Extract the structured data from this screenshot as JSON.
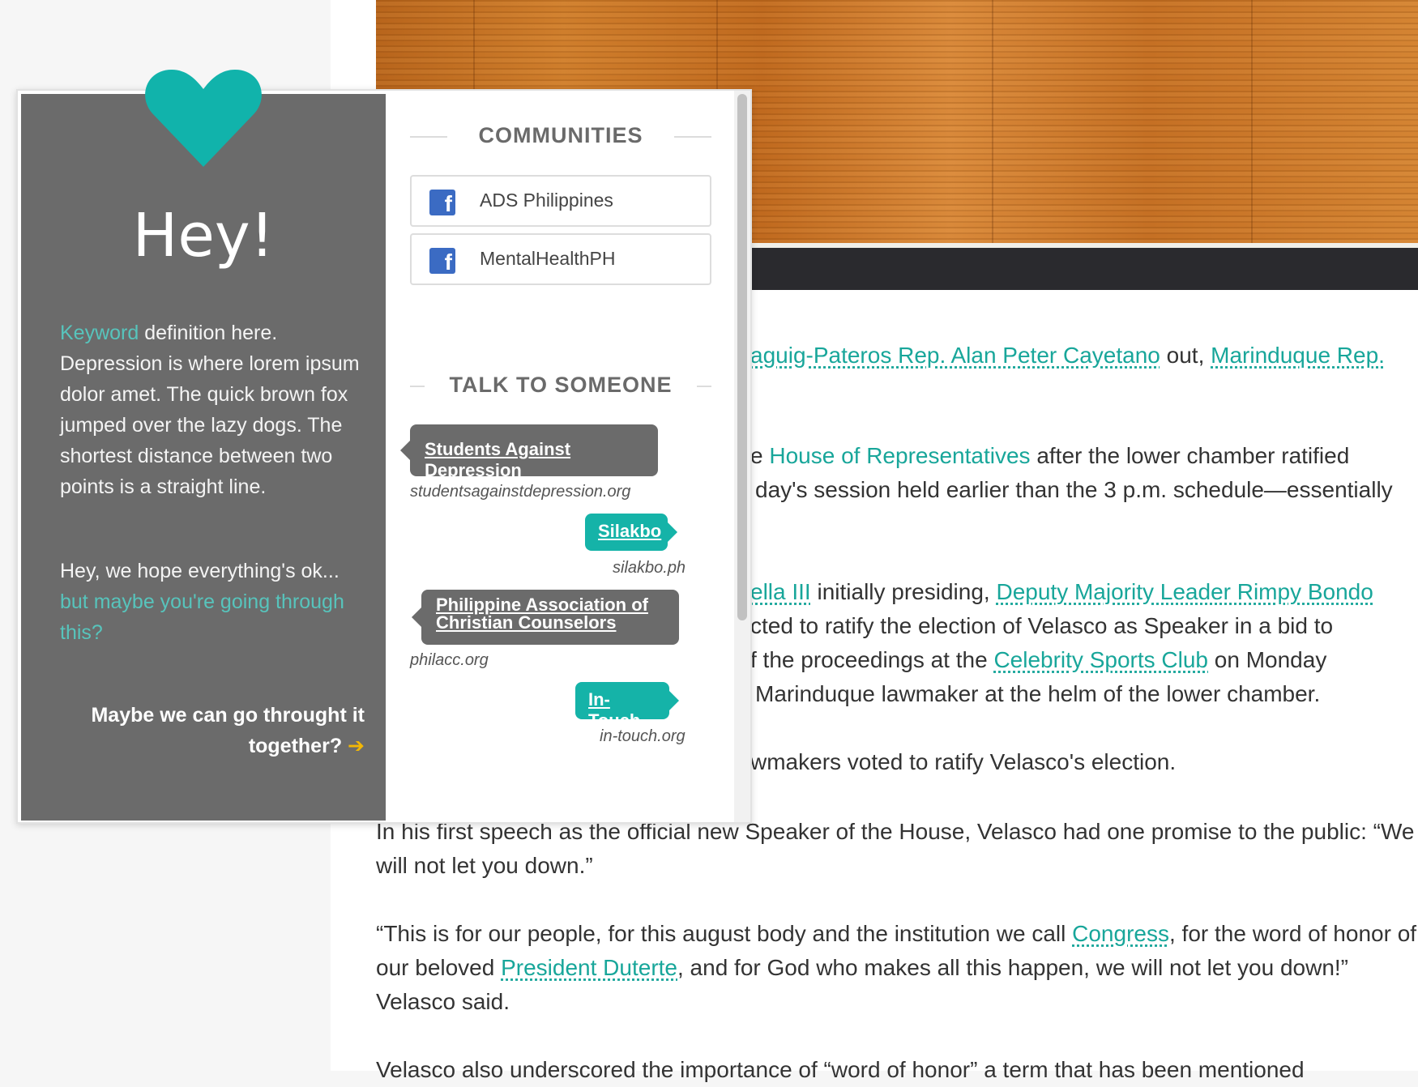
{
  "popup": {
    "heading": "Hey!",
    "keyword": "Keyword",
    "definition": " definition here. Depression is where lorem ipsum dolor amet. The quick brown fox jumped over the lazy dogs. The shortest distance between two points is a straight line.",
    "hope_line": "Hey, we hope everything's ok...",
    "hope_teal": "but maybe you're going through this?",
    "together": "Maybe we can go throught it together?",
    "arrow": "➔",
    "communities_title": "COMMUNITIES",
    "communities": [
      "ADS Philippines",
      "MentalHealthPH"
    ],
    "talk_title": "TALK TO SOMEONE",
    "contacts": [
      {
        "name": "Students Against Depression",
        "url": "studentsagainstdepression.org"
      },
      {
        "name": "Silakbo",
        "url": "silakbo.ph"
      },
      {
        "name": "Philippine Association of Christian Counselors",
        "url": "philacc.org"
      },
      {
        "name": "In-Touch",
        "url": "in-touch.org"
      }
    ],
    "heart_color": "#11b3ab"
  },
  "article": {
    "frag1_a": "aguig-Pateros Rep. Alan Peter Cayetano",
    "frag1_b": " out, ",
    "frag1_c": "Marinduque Rep.",
    "frag2_a": "e ",
    "frag2_b": "House of Representatives",
    "frag2_c": " after the lower chamber ratified",
    "frag3": "day's session held earlier than the 3 p.m. schedule—essentially",
    "frag4_a": "ella III",
    "frag4_b": " initially presiding, ",
    "frag4_c": "Deputy Majority Leader Rimpy Bondo",
    "frag5": "cted to ratify the election of Velasco as Speaker in a bid to",
    "frag6_a": "f the proceedings at the ",
    "frag6_b": "Celebrity Sports Club",
    "frag6_c": " on Monday",
    "frag7": "Marinduque lawmaker at the helm of the lower chamber.",
    "frag8": "wmakers voted to ratify Velasco's election.",
    "p_speech": "In his first speech as the official new Speaker of the House, Velasco had one promise to the public: “We will not let you down.”",
    "p_quote_1": "“This is for our people, for this august body and the institution we call ",
    "p_quote_link1": "Congress",
    "p_quote_2": ", for the word of honor of our beloved ",
    "p_quote_link2": "President Duterte",
    "p_quote_3": ", and for God who makes all this happen, we will not let you down!” Velasco said.",
    "p_last": "Velasco also underscored the importance of “word of honor” a term that has been mentioned"
  }
}
